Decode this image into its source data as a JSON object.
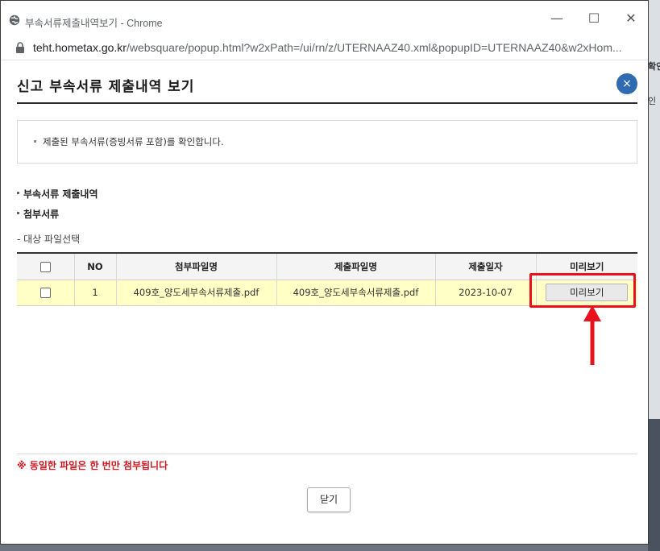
{
  "window": {
    "title": "부속서류제출내역보기 - Chrome",
    "url_host": "teht.hometax.go.kr",
    "url_path": "/websquare/popup.html?w2xPath=/ui/rn/z/UTERNAAZ40.xml&popupID=UTERNAAZ40&w2xHom..."
  },
  "background": {
    "text1": "확인",
    "text2": "인"
  },
  "popup": {
    "title": "신고 부속서류 제출내역 보기",
    "close_icon": "×",
    "notice": "제출된 부속서류(증빙서류 포함)를 확인합니다.",
    "section1": "부속서류 제출내역",
    "section2": "첨부서류",
    "sub_label": "- 대상 파일선택",
    "table": {
      "headers": [
        "NO",
        "첨부파일명",
        "제출파일명",
        "제출일자",
        "미리보기"
      ],
      "rows": [
        {
          "no": "1",
          "attach_name": "409호_양도세부속서류제출.pdf",
          "submit_name": "409호_양도세부속서류제출.pdf",
          "date": "2023-10-07",
          "preview_label": "미리보기"
        }
      ]
    },
    "warning": "※ 동일한 파일은 한 번만 첨부됩니다",
    "close_label": "닫기"
  },
  "colors": {
    "highlight": "#e8111c",
    "row_bg": "#ffffc6",
    "close_circle": "#2e6bb0"
  }
}
